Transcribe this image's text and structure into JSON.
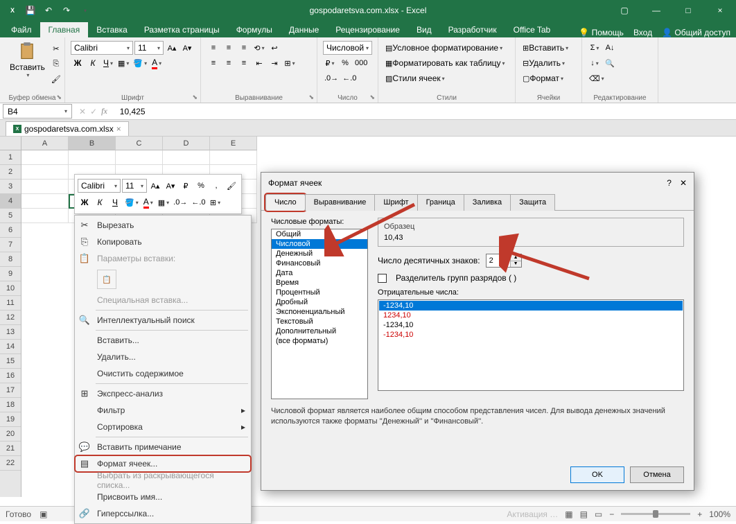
{
  "titlebar": {
    "title": "gospodaretsva.com.xlsx - Excel",
    "min": "—",
    "max": "□",
    "close": "×",
    "ribbonmin": "▢"
  },
  "tabs": {
    "file": "Файл",
    "home": "Главная",
    "insert": "Вставка",
    "layout": "Разметка страницы",
    "formulas": "Формулы",
    "data": "Данные",
    "review": "Рецензирование",
    "view": "Вид",
    "developer": "Разработчик",
    "officetab": "Office Tab",
    "help": "Помощь",
    "signin": "Вход",
    "share": "Общий доступ"
  },
  "ribbon": {
    "clipboard": {
      "paste": "Вставить",
      "label": "Буфер обмена"
    },
    "font": {
      "name": "Calibri",
      "size": "11",
      "label": "Шрифт"
    },
    "align": {
      "label": "Выравнивание"
    },
    "number": {
      "format": "Числовой",
      "label": "Число"
    },
    "styles": {
      "cond": "Условное форматирование",
      "table": "Форматировать как таблицу",
      "cell": "Стили ячеек",
      "label": "Стили"
    },
    "cells": {
      "insert": "Вставить",
      "delete": "Удалить",
      "format": "Формат",
      "label": "Ячейки"
    },
    "editing": {
      "label": "Редактирование"
    }
  },
  "namebox": "B4",
  "formula": "10,425",
  "filetab": "gospodaretsva.com.xlsx",
  "cols": [
    "A",
    "B",
    "C",
    "D",
    "E"
  ],
  "mini": {
    "font": "Calibri",
    "size": "11"
  },
  "context": {
    "cut": "Вырезать",
    "copy": "Копировать",
    "pasteopts": "Параметры вставки:",
    "pastespecial": "Специальная вставка...",
    "smartlookup": "Интеллектуальный поиск",
    "insert": "Вставить...",
    "delete": "Удалить...",
    "clear": "Очистить содержимое",
    "quickanalysis": "Экспресс-анализ",
    "filter": "Фильтр",
    "sort": "Сортировка",
    "comment": "Вставить примечание",
    "formatcells": "Формат ячеек...",
    "picklist": "Выбрать из раскрывающегося списка...",
    "definename": "Присвоить имя...",
    "hyperlink": "Гиперссылка..."
  },
  "dialog": {
    "title": "Формат ячеек",
    "tabs": {
      "number": "Число",
      "align": "Выравнивание",
      "font": "Шрифт",
      "border": "Граница",
      "fill": "Заливка",
      "protect": "Защита"
    },
    "catlabel": "Числовые форматы:",
    "cats": [
      "Общий",
      "Числовой",
      "Денежный",
      "Финансовый",
      "Дата",
      "Время",
      "Процентный",
      "Дробный",
      "Экспоненциальный",
      "Текстовый",
      "Дополнительный",
      "(все форматы)"
    ],
    "sample_lbl": "Образец",
    "sample_val": "10,43",
    "decimals_lbl": "Число десятичных знаков:",
    "decimals_val": "2",
    "sep_lbl": "Разделитель групп разрядов ( )",
    "neg_lbl": "Отрицательные числа:",
    "neg": [
      "-1234,10",
      "1234,10",
      "-1234,10",
      "-1234,10"
    ],
    "desc": "Числовой формат является наиболее общим способом представления чисел. Для вывода денежных значений используются также форматы ''Денежный'' и ''Финансовый''.",
    "ok": "OK",
    "cancel": "Отмена"
  },
  "status": {
    "ready": "Готово",
    "zoom": "100%",
    "activation": "Активация …"
  }
}
